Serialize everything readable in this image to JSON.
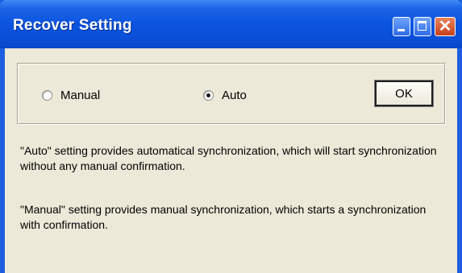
{
  "window": {
    "title": "Recover Setting"
  },
  "titlebar_buttons": {
    "minimize_icon": "minimize-icon",
    "maximize_icon": "maximize-icon",
    "close_icon": "close-icon",
    "close_glyph": "✕"
  },
  "mode": {
    "options": [
      {
        "label": "Manual",
        "selected": false
      },
      {
        "label": "Auto",
        "selected": true
      }
    ]
  },
  "ok_button": {
    "label": "OK"
  },
  "descriptions": {
    "auto": "\"Auto\" setting provides automatical synchronization, which will start synchronization without any manual confirmation.",
    "manual": "\"Manual\" setting provides manual synchronization, which starts a synchronization with confirmation."
  },
  "colors": {
    "titlebar": "#0b54e0",
    "dialog_background": "#ece9d8",
    "close_button": "#c7401b"
  }
}
